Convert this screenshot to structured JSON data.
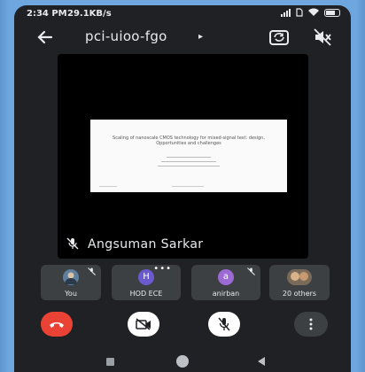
{
  "status_bar": {
    "time": "2:34 PM",
    "network_speed": "29.1KB/s"
  },
  "meeting": {
    "code": "pci-uioo-fgo",
    "caret": "▸"
  },
  "presentation": {
    "slide_title": "Scaling of nanoscale CMOS technology for mixed-signal test: design, Opportunities and challenges"
  },
  "speaker": {
    "name": "Angsuman Sarkar"
  },
  "participants": [
    {
      "label": "You",
      "avatar_type": "photo",
      "muted": true
    },
    {
      "label": "HOD ECE",
      "initial": "H",
      "avatar_color": "#6a5acd",
      "more_indicator": "•••"
    },
    {
      "label": "anirban",
      "initial": "a",
      "avatar_color": "#9c6ad4",
      "muted": true
    },
    {
      "label": "20 others",
      "avatar_type": "photo"
    }
  ],
  "controls": {
    "end_call": "phone-hangup-icon",
    "camera": "camera-off-icon",
    "mic": "mic-off-icon",
    "more": "more-vert-icon",
    "end_color": "#ea4335"
  },
  "nav": {
    "recent": "square-icon",
    "home": "circle-icon",
    "back": "triangle-back-icon"
  }
}
